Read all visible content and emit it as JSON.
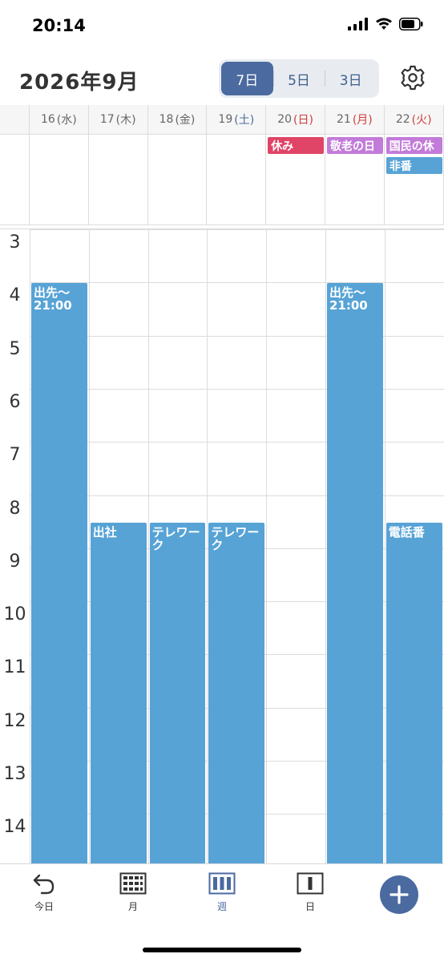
{
  "status_bar": {
    "time": "20:14"
  },
  "header": {
    "title": "2026年9月",
    "view_options": [
      "7日",
      "5日",
      "3日"
    ],
    "active_view": "7日"
  },
  "days": [
    {
      "num": "16",
      "wd": "(水)",
      "type": "weekday"
    },
    {
      "num": "17",
      "wd": "(木)",
      "type": "weekday"
    },
    {
      "num": "18",
      "wd": "(金)",
      "type": "weekday"
    },
    {
      "num": "19",
      "wd": "(土)",
      "type": "saturday"
    },
    {
      "num": "20",
      "wd": "(日)",
      "type": "sunday"
    },
    {
      "num": "21",
      "wd": "(月)",
      "type": "sunday"
    },
    {
      "num": "22",
      "wd": "(火)",
      "type": "sunday"
    }
  ],
  "all_day_events": [
    {
      "day": 4,
      "row": 0,
      "title": "休み",
      "color": "red"
    },
    {
      "day": 5,
      "row": 0,
      "title": "敬老の日",
      "color": "purple"
    },
    {
      "day": 6,
      "row": 0,
      "title": "国民の休",
      "color": "purple"
    },
    {
      "day": 6,
      "row": 1,
      "title": "非番",
      "color": "blue"
    }
  ],
  "hours": [
    "3",
    "4",
    "5",
    "6",
    "7",
    "8",
    "9",
    "10",
    "11",
    "12",
    "13",
    "14"
  ],
  "timed_events": [
    {
      "day": 0,
      "start": 4.0,
      "title": "出先〜21:00"
    },
    {
      "day": 1,
      "start": 8.5,
      "title": "出社"
    },
    {
      "day": 2,
      "start": 8.5,
      "title": "テレワーク"
    },
    {
      "day": 3,
      "start": 8.5,
      "title": "テレワーク"
    },
    {
      "day": 5,
      "start": 4.0,
      "title": "出先〜21:00"
    },
    {
      "day": 6,
      "start": 8.5,
      "title": "電話番"
    }
  ],
  "tabbar": {
    "today": "今日",
    "month": "月",
    "week": "週",
    "day": "日"
  },
  "colors": {
    "accent": "#4a6aa0",
    "event_blue": "#57a3d6",
    "holiday_red": "#e04466",
    "holiday_purple": "#c27bd9",
    "sunday_text": "#d23c3c",
    "saturday_text": "#4a6aa0"
  }
}
